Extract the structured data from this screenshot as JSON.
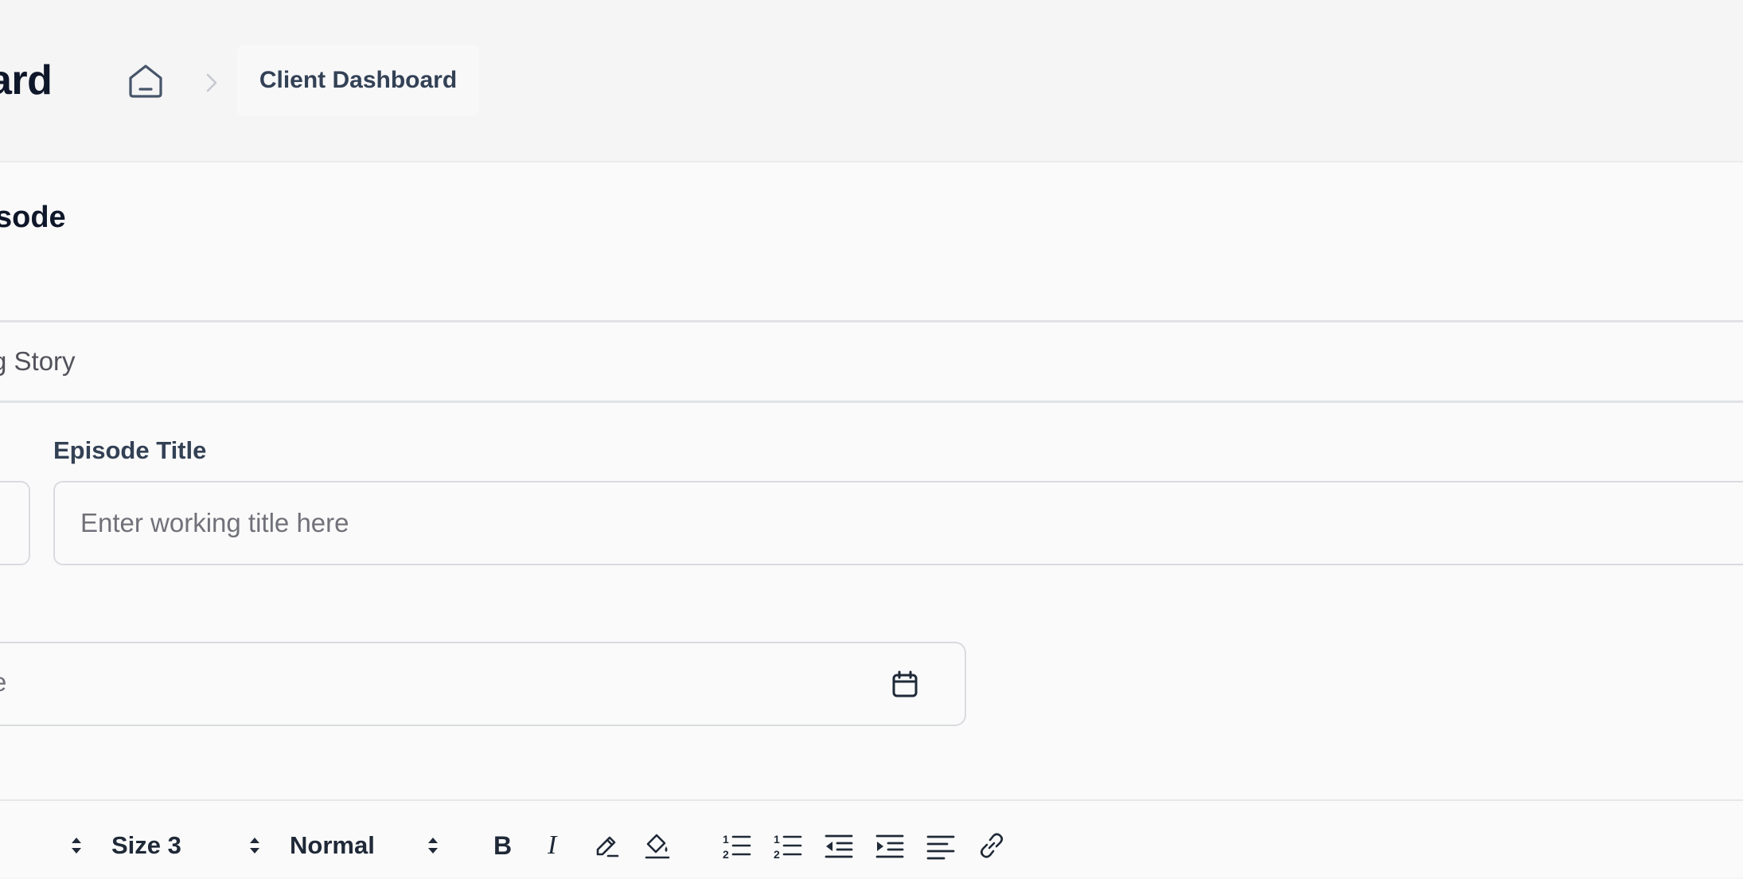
{
  "header": {
    "title": "ard",
    "breadcrumb": {
      "home_icon": "home-icon",
      "separator_icon": "chevron-right-icon",
      "current": "Client Dashboard"
    }
  },
  "form": {
    "heading": "sode",
    "show_field": {
      "value": "g Story"
    },
    "episode_title": {
      "label": "Episode Title",
      "placeholder": "Enter working title here",
      "value": ""
    },
    "date_field": {
      "value": "e",
      "icon": "calendar-icon"
    }
  },
  "toolbar": {
    "font_size": "Size 3",
    "format": "Normal",
    "buttons": [
      "bold-icon",
      "italic-icon",
      "text-color-icon",
      "highlight-icon",
      "ordered-list-icon",
      "numbered-list-icon",
      "outdent-icon",
      "indent-icon",
      "align-icon",
      "link-icon"
    ],
    "bold_glyph": "B",
    "italic_glyph": "I"
  },
  "colors": {
    "background": "#f6f6f7",
    "card": "#fafafa",
    "border": "#d9dbe0",
    "text": "#0f172a",
    "label": "#334155",
    "muted": "#71717a"
  }
}
